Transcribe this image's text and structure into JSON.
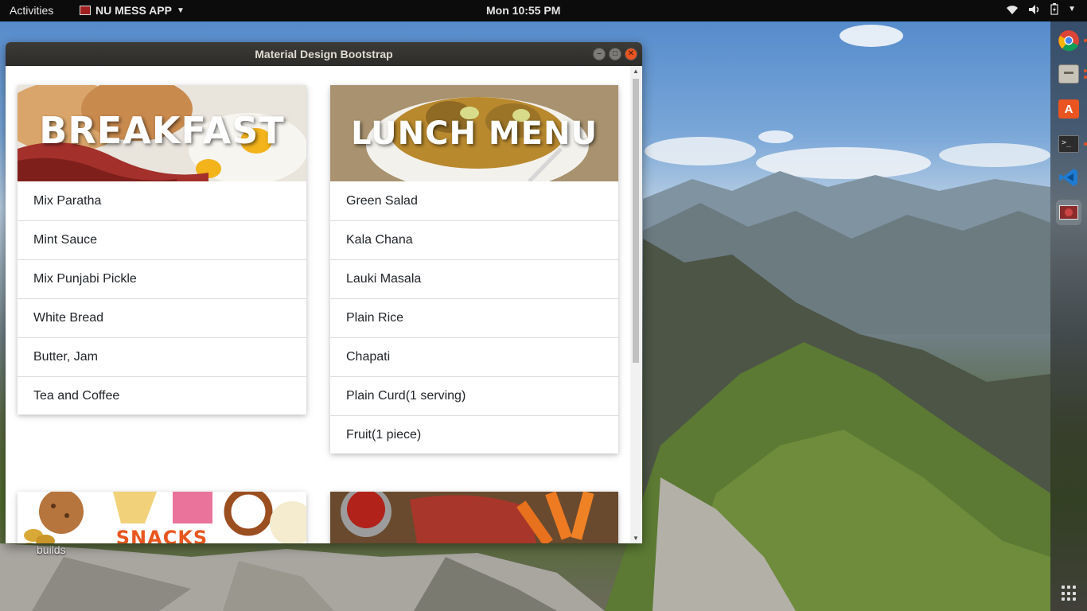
{
  "topbar": {
    "activities": "Activities",
    "app_menu": "NU MESS APP",
    "clock": "Mon 10:55 PM"
  },
  "window": {
    "title": "Material Design Bootstrap"
  },
  "cards": {
    "breakfast": {
      "title": "BREAKFAST",
      "items": [
        "Mix Paratha",
        "Mint Sauce",
        "Mix Punjabi Pickle",
        "White Bread",
        "Butter, Jam",
        "Tea and Coffee"
      ]
    },
    "lunch": {
      "title": "LUNCH MENU",
      "items": [
        "Green Salad",
        "Kala Chana",
        "Lauki Masala",
        "Plain Rice",
        "Chapati",
        "Plain Curd(1 serving)",
        "Fruit(1 piece)"
      ]
    },
    "snacks": {
      "title": "SNACKS"
    }
  },
  "desktop": {
    "folder_label": "builds"
  },
  "dock": {
    "items": [
      "chrome-icon",
      "files-icon",
      "software-icon",
      "terminal-icon",
      "vscode-icon",
      "app-icon"
    ]
  },
  "colors": {
    "accent": "#e95420",
    "titlebar": "#3c3b37",
    "topbar": "#0c0c0c"
  }
}
